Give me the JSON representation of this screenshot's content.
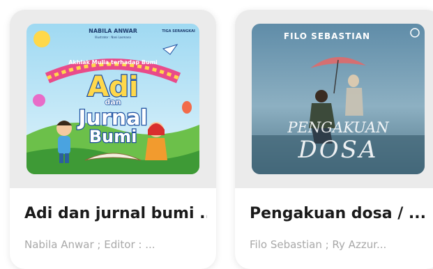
{
  "books": [
    {
      "title": "Adi dan jurnal bumi ...",
      "author": "Nabila Anwar ; Editor : ...",
      "cover": {
        "author": "NABILA ANWAR",
        "illustrator": "Illustrator : Nani Lasmana",
        "publisher": "TIGA SERANGKAI",
        "subtitle": "Akhlak Mulia terhadap Bumi",
        "title_line1": "Adi",
        "title_line2": "dan",
        "title_line3": "Jurnal",
        "title_line4": "Bumi"
      }
    },
    {
      "title": "Pengakuan dosa / ...",
      "author": "Filo Sebastian ; Ry Azzur...",
      "cover": {
        "author": "FILO SEBASTIAN",
        "title_line1": "PENGAKUAN",
        "title_line2": "DOSA"
      }
    }
  ],
  "colors": {
    "card_bg": "#ffffff",
    "cover_area_bg": "#ebebeb",
    "title_text": "#1a1a1a",
    "author_text": "#a8a8a8"
  }
}
